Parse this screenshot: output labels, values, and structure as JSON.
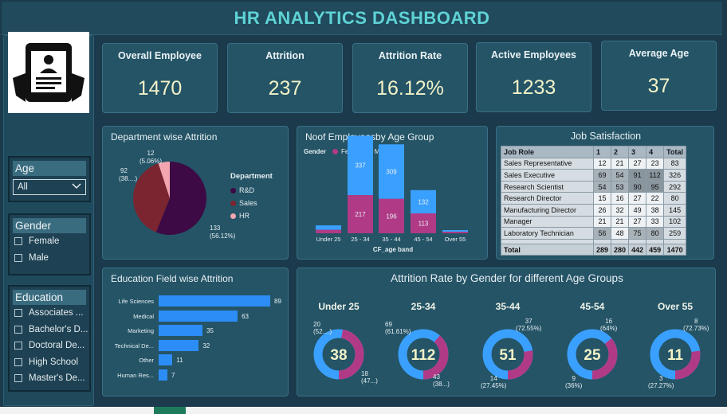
{
  "title": "HR ANALYTICS DASHBOARD",
  "kpis": [
    {
      "label": "Overall Employee",
      "value": "1470"
    },
    {
      "label": "Attrition",
      "value": "237"
    },
    {
      "label": "Attrition Rate",
      "value": "16.12%"
    },
    {
      "label": "Active Employees",
      "value": "1233"
    },
    {
      "label": "Average Age",
      "value": "37"
    }
  ],
  "filters": {
    "age": {
      "title": "Age",
      "selected": "All"
    },
    "gender": {
      "title": "Gender",
      "options": [
        "Female",
        "Male"
      ]
    },
    "education": {
      "title": "Education",
      "options": [
        "Associates ...",
        "Bachelor's D...",
        "Doctoral De...",
        "High School",
        "Master's De..."
      ]
    }
  },
  "dept_panel": {
    "title": "Department wise Attrition",
    "legend_title": "Department"
  },
  "age_panel": {
    "title": "Noof Employeesby Age Group",
    "legend_title": "Gender",
    "xlabel": "CF_age band"
  },
  "job_panel": {
    "title": "Job Satisfaction"
  },
  "edu_panel": {
    "title": "Education Field wise Attrition"
  },
  "gender_age_panel": {
    "title": "Attrition Rate by Gender for different Age Groups"
  },
  "chart_data": [
    {
      "type": "pie",
      "title": "Department wise Attrition",
      "legend_title": "Department",
      "categories": [
        "R&D",
        "Sales",
        "HR"
      ],
      "values": [
        133,
        92,
        12
      ],
      "labels": [
        "133\n(56.12%)",
        "92\n(38....)",
        "12\n(5.06%)"
      ],
      "colors": [
        "#3d0a45",
        "#7b2530",
        "#f4a6b0"
      ]
    },
    {
      "type": "bar",
      "title": "Noof Employeesby Age Group",
      "legend_title": "Gender",
      "xlabel": "CF_age band",
      "categories": [
        "Under 25",
        "25 - 34",
        "35 - 44",
        "45 - 54",
        "Over 55"
      ],
      "series": [
        {
          "name": "Female",
          "values": [
            null,
            217,
            196,
            113,
            null
          ],
          "color": "#b13a86"
        },
        {
          "name": "Male",
          "values": [
            null,
            337,
            309,
            132,
            null
          ],
          "color": "#3aa0ff"
        }
      ],
      "approx_female": [
        20,
        217,
        196,
        113,
        9
      ],
      "approx_male": [
        25,
        337,
        309,
        132,
        9
      ]
    },
    {
      "type": "table",
      "title": "Job Satisfaction",
      "columns": [
        "Job Role",
        "1",
        "2",
        "3",
        "4",
        "Total"
      ],
      "rows": [
        [
          "Sales Representative",
          "12",
          "21",
          "27",
          "23",
          "83"
        ],
        [
          "Sales Executive",
          "69",
          "54",
          "91",
          "112",
          "326"
        ],
        [
          "Research Scientist",
          "54",
          "53",
          "90",
          "95",
          "292"
        ],
        [
          "Research Director",
          "15",
          "16",
          "27",
          "22",
          "80"
        ],
        [
          "Manufacturing Director",
          "26",
          "32",
          "49",
          "38",
          "145"
        ],
        [
          "Manager",
          "21",
          "21",
          "27",
          "33",
          "102"
        ],
        [
          "Laboratory Technician",
          "56",
          "48",
          "75",
          "80",
          "259"
        ]
      ],
      "total": [
        "Total",
        "289",
        "280",
        "442",
        "459",
        "1470"
      ]
    },
    {
      "type": "bar",
      "title": "Education Field wise Attrition",
      "categories": [
        "Life Sciences",
        "Medical",
        "Marketing",
        "Technical De...",
        "Other",
        "Human Res..."
      ],
      "values": [
        89,
        63,
        35,
        32,
        11,
        7
      ],
      "color": "#2b8df5"
    },
    {
      "type": "pie",
      "title": "Attrition Rate by Gender for different Age Groups",
      "groups": [
        {
          "name": "Under 25",
          "total": "38",
          "female": "18",
          "female_pct": "(47...)",
          "male": "20",
          "male_pct": "(52....)",
          "female_frac": 0.474
        },
        {
          "name": "25-34",
          "total": "112",
          "female": "43",
          "female_pct": "(38...)",
          "male": "69",
          "male_pct": "(61.61%)",
          "female_frac": 0.384
        },
        {
          "name": "35-44",
          "total": "51",
          "female": "14",
          "female_pct": "(27.45%)",
          "male": "37",
          "male_pct": "(72.55%)",
          "female_frac": 0.2745
        },
        {
          "name": "45-54",
          "total": "25",
          "female": "9",
          "female_pct": "(36%)",
          "male": "16",
          "male_pct": "(64%)",
          "female_frac": 0.36
        },
        {
          "name": "Over 55",
          "total": "11",
          "female": "3",
          "female_pct": "(27.27%)",
          "male": "8",
          "male_pct": "(72.73%)",
          "female_frac": 0.2727
        }
      ],
      "colors": {
        "female": "#b13a86",
        "male": "#3aa0ff"
      }
    }
  ]
}
